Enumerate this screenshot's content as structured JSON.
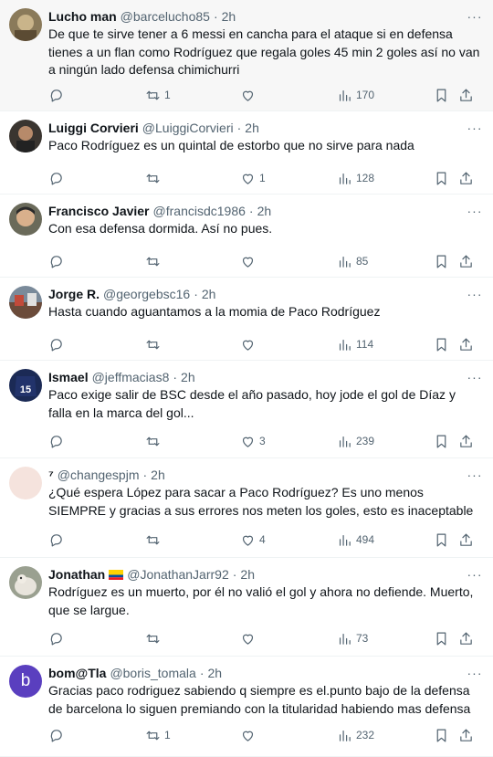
{
  "tweets": [
    {
      "name": "Lucho man",
      "handle": "@barcelucho85",
      "time": "2h",
      "text": "De que te sirve tener a 6 messi en cancha para el ataque si en defensa tienes a un flan como Rodríguez que regala goles 45 min 2 goles así no van a ningún lado defensa chimichurri",
      "replies": "",
      "retweets": "1",
      "likes": "",
      "views": "170"
    },
    {
      "name": "Luiggi Corvieri",
      "handle": "@LuiggiCorvieri",
      "time": "2h",
      "text": "Paco Rodríguez es un quintal de estorbo que no sirve para nada",
      "replies": "",
      "retweets": "",
      "likes": "1",
      "views": "128"
    },
    {
      "name": "Francisco Javier",
      "handle": "@francisdc1986",
      "time": "2h",
      "text": "Con esa defensa dormida. Así no pues.",
      "replies": "",
      "retweets": "",
      "likes": "",
      "views": "85"
    },
    {
      "name": "Jorge R.",
      "handle": "@georgebsc16",
      "time": "2h",
      "text": "Hasta cuando aguantamos a la momia de Paco Rodríguez",
      "replies": "",
      "retweets": "",
      "likes": "",
      "views": "114"
    },
    {
      "name": "Ismael",
      "handle": "@jeffmacias8",
      "time": "2h",
      "text": "Paco exige salir de BSC desde el año pasado, hoy jode el gol de Díaz y falla en la marca del gol...",
      "replies": "",
      "retweets": "",
      "likes": "3",
      "views": "239"
    },
    {
      "name": "⁷",
      "handle": "@changespjm",
      "time": "2h",
      "text": "¿Qué espera López para sacar a Paco Rodríguez? Es uno menos SIEMPRE y gracias a sus errores nos meten los goles, esto es inaceptable",
      "replies": "",
      "retweets": "",
      "likes": "4",
      "views": "494"
    },
    {
      "name": "Jonathan",
      "handle": "@JonathanJarr92",
      "time": "2h",
      "text": "Rodríguez es un muerto, por él no valió el gol y ahora no defiende. Muerto, que se largue.",
      "replies": "",
      "retweets": "",
      "likes": "",
      "views": "73"
    },
    {
      "name": "bom@Tla",
      "handle": "@boris_tomala",
      "time": "2h",
      "text": "Gracias paco rodriguez sabiendo q siempre es el.punto bajo de la defensa de barcelona lo siguen premiando con la titularidad habiendo mas defensa",
      "replies": "",
      "retweets": "1",
      "likes": "",
      "views": "232"
    }
  ],
  "ui": {
    "separator": "·",
    "more_glyph": "···",
    "avatar_b_letter": "b",
    "jersey_number": "15"
  },
  "colors": {
    "text": "#0f1419",
    "secondary": "#536471",
    "highlight_bg": "#f7f7f7",
    "border": "#eff3f4",
    "avatar_b_bg": "#5a3fbf"
  },
  "icons": [
    "reply-icon",
    "retweet-icon",
    "like-icon",
    "views-icon",
    "bookmark-icon",
    "share-icon",
    "more-icon"
  ]
}
